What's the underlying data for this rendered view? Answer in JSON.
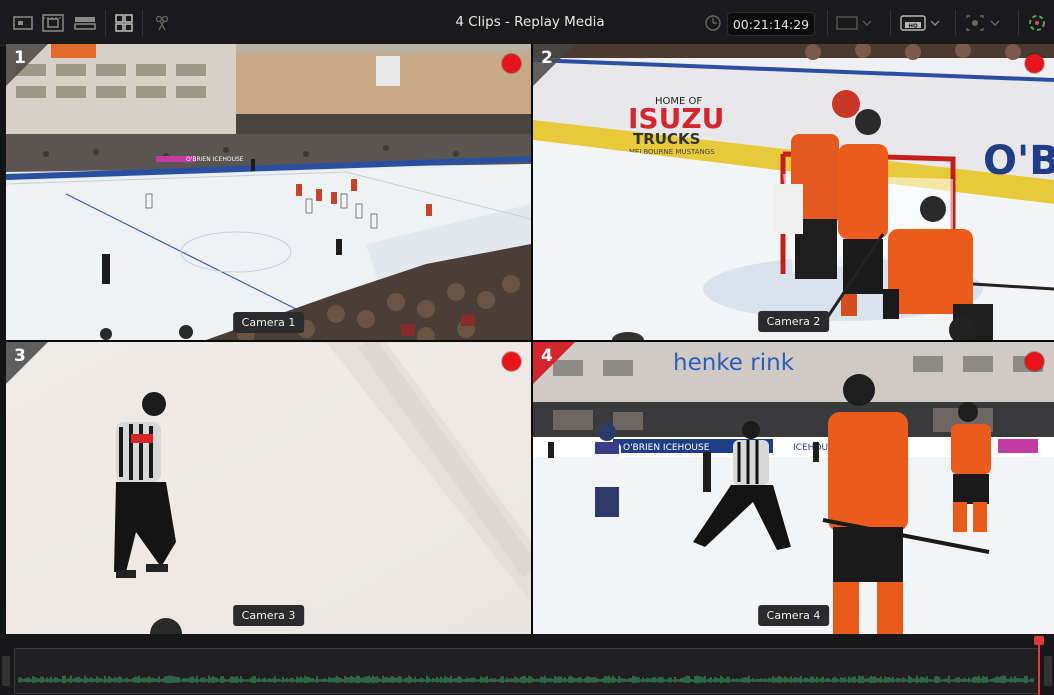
{
  "title": "4 Clips - Replay Media",
  "timecode": "00:21:14:29",
  "toolbar": {
    "left_icons": [
      "media-pool-icon",
      "clip-viewer-icon",
      "timeline-icon",
      "multiview-icon",
      "cut-icon"
    ],
    "right_dropdowns": [
      "layout-dropdown",
      "quality-dropdown",
      "tracker-dropdown"
    ],
    "quality_label": "HQ"
  },
  "tiles": [
    {
      "number": "1",
      "camera": "Camera 1",
      "recording": true,
      "active": false
    },
    {
      "number": "2",
      "camera": "Camera 2",
      "recording": true,
      "active": false
    },
    {
      "number": "3",
      "camera": "Camera 3",
      "recording": true,
      "active": false
    },
    {
      "number": "4",
      "camera": "Camera 4",
      "recording": true,
      "active": true
    }
  ],
  "arena_signs": {
    "isuzu": "ISUZU",
    "trucks": "TRUCKS",
    "isuzu_sub": "HOME OF",
    "isuzu_sub2": "MELBOURNE MUSTANGS",
    "obrien": "O'B",
    "henke": "henke rink",
    "obrien_board": "O'BRIEN ICEHOUSE",
    "ice_house": "ICEHOUSE"
  },
  "colors": {
    "accent": "#d2262c",
    "record": "#e8141b",
    "waveform": "#3ea96e"
  }
}
